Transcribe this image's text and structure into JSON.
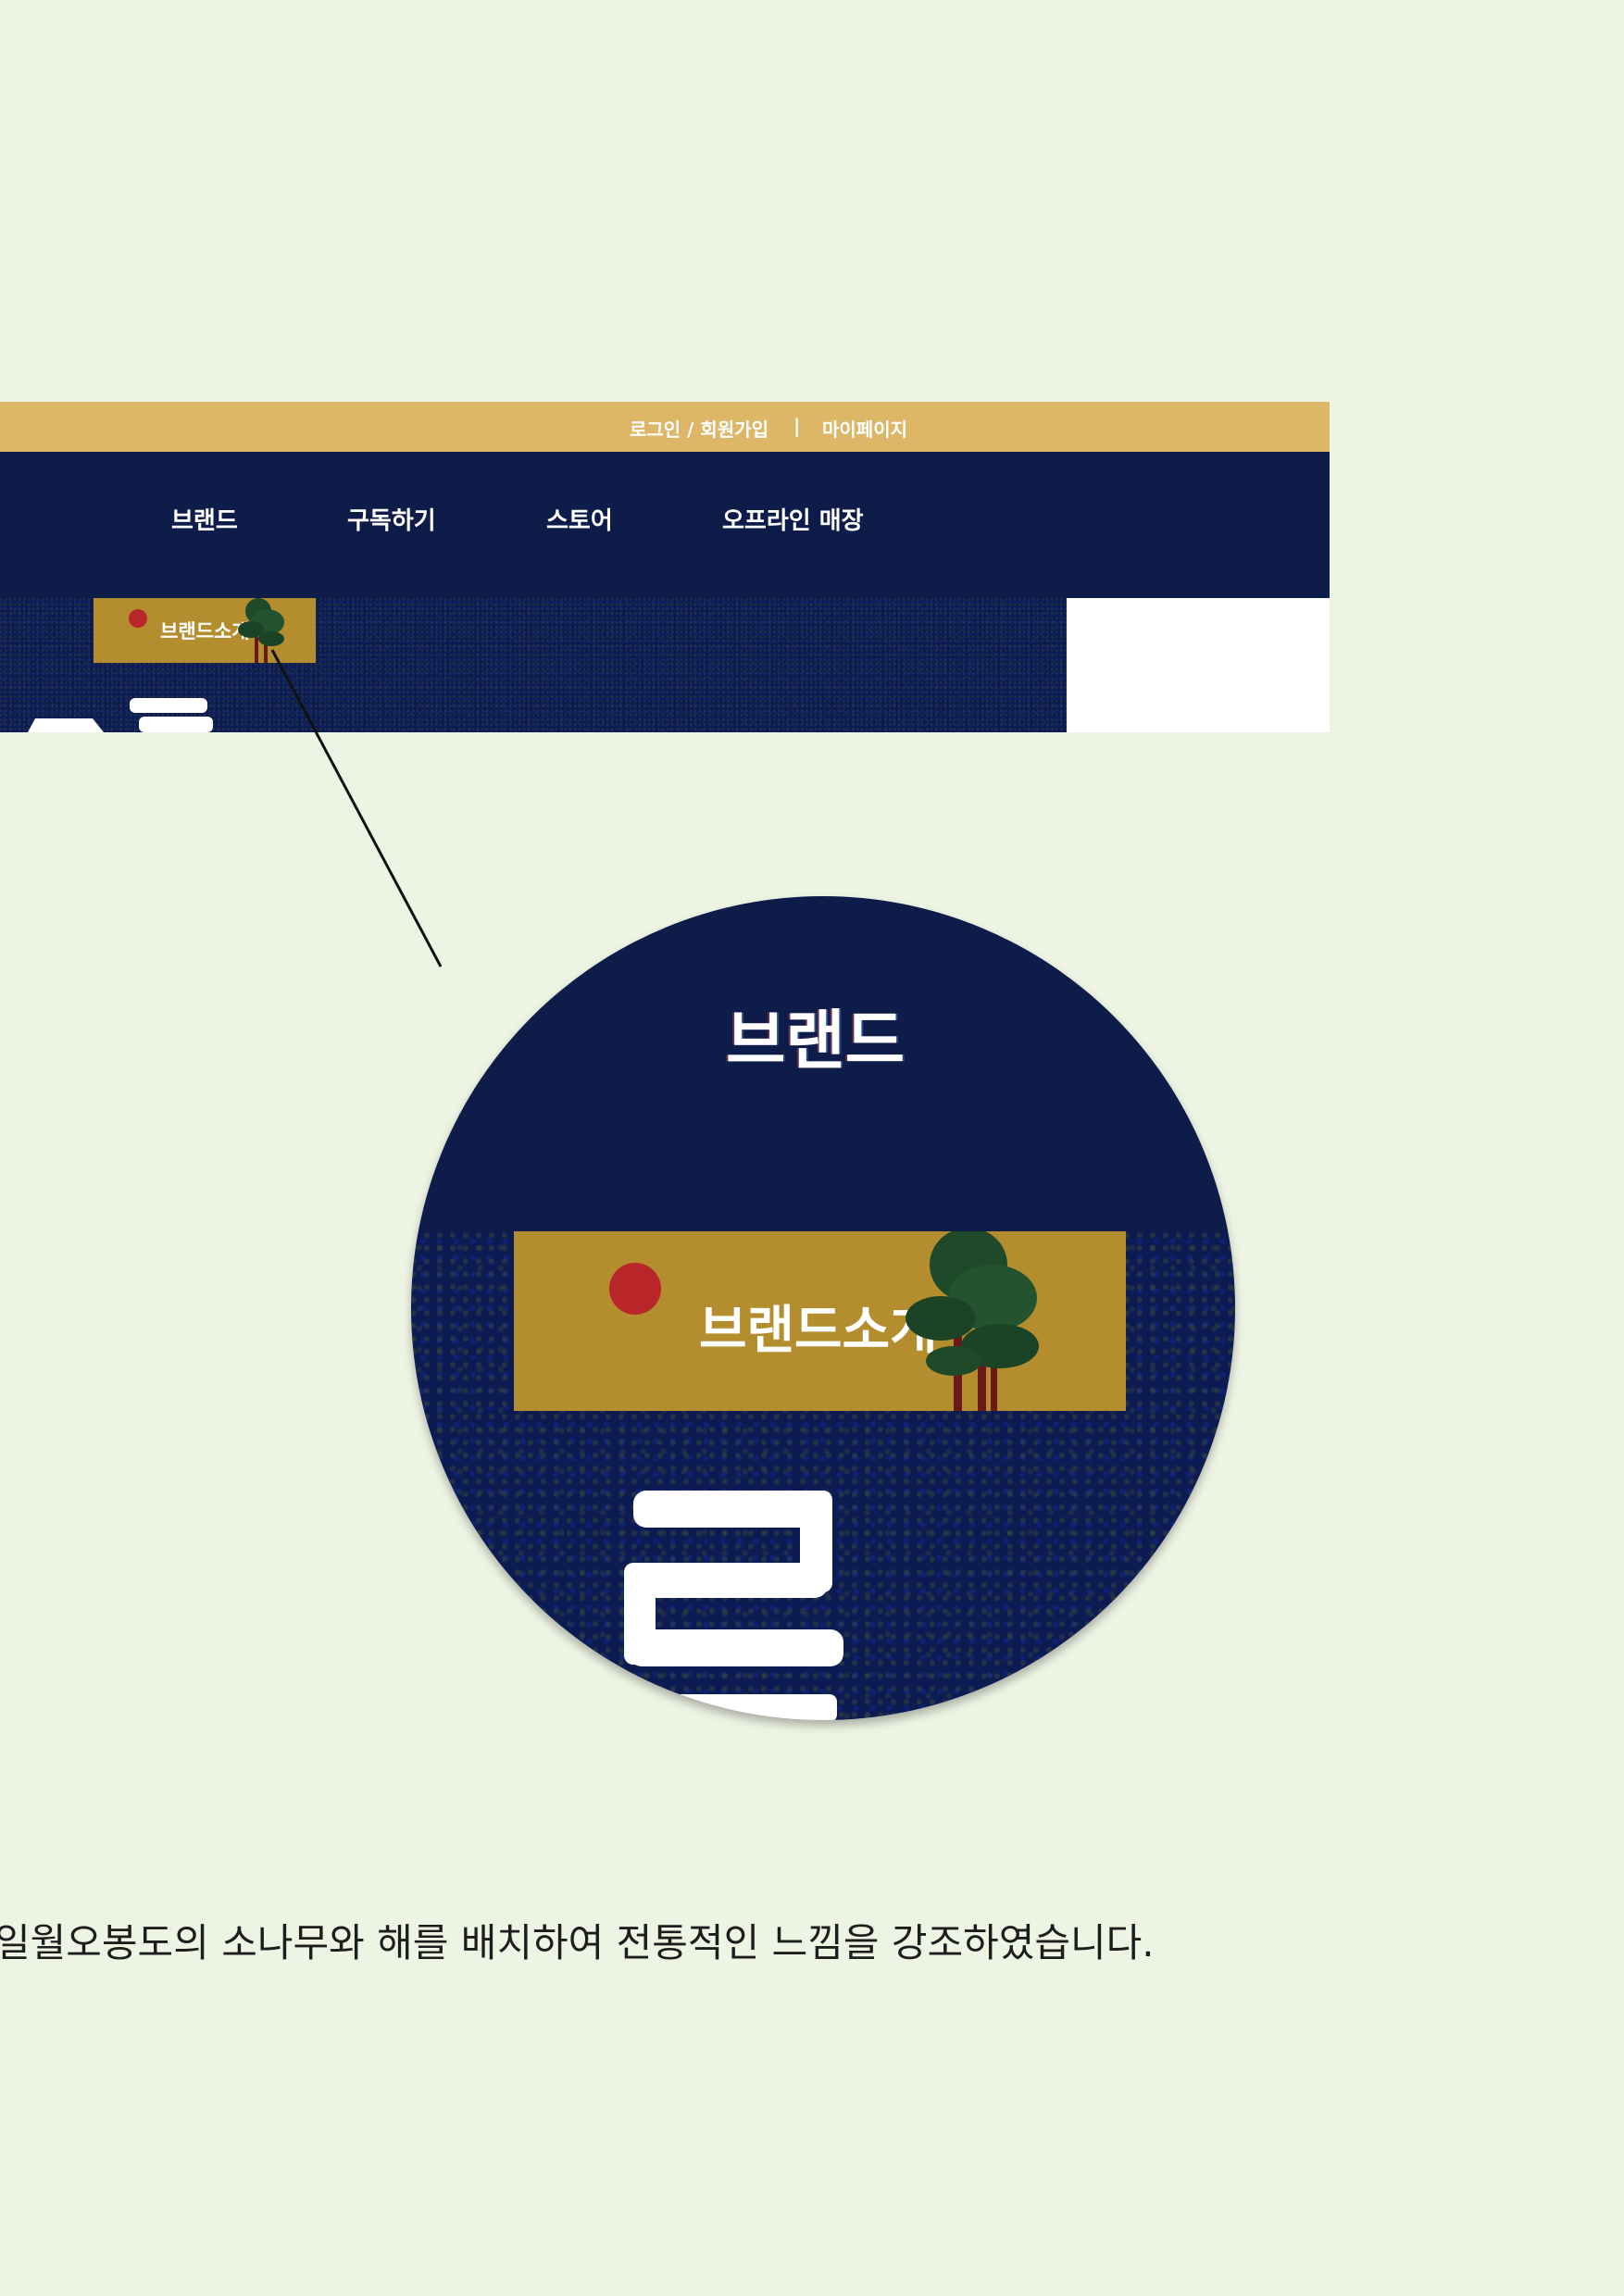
{
  "site": {
    "topbar": {
      "login_label": "로그인 / 회원가입",
      "separator": "|",
      "mypage_label": "마이페이지"
    },
    "nav": {
      "items": [
        "브랜드",
        "구독하기",
        "스토어",
        "오프라인 매장"
      ]
    },
    "hero": {
      "badge_label": "브랜드소개"
    }
  },
  "magnifier": {
    "nav_label": "브랜드",
    "badge_label": "브랜드소개"
  },
  "caption": "일월오봉도의 소나무와 해를 배치하여 전통적인 느낌을 강조하였습니다.",
  "colors": {
    "background": "#eef4e4",
    "topbar": "#ddb767",
    "navy": "#0e1c4a",
    "badge_gold": "#b38d2e",
    "sun_red": "#b8262a"
  },
  "icons": [
    "sun-icon",
    "pine-tree-icon"
  ]
}
